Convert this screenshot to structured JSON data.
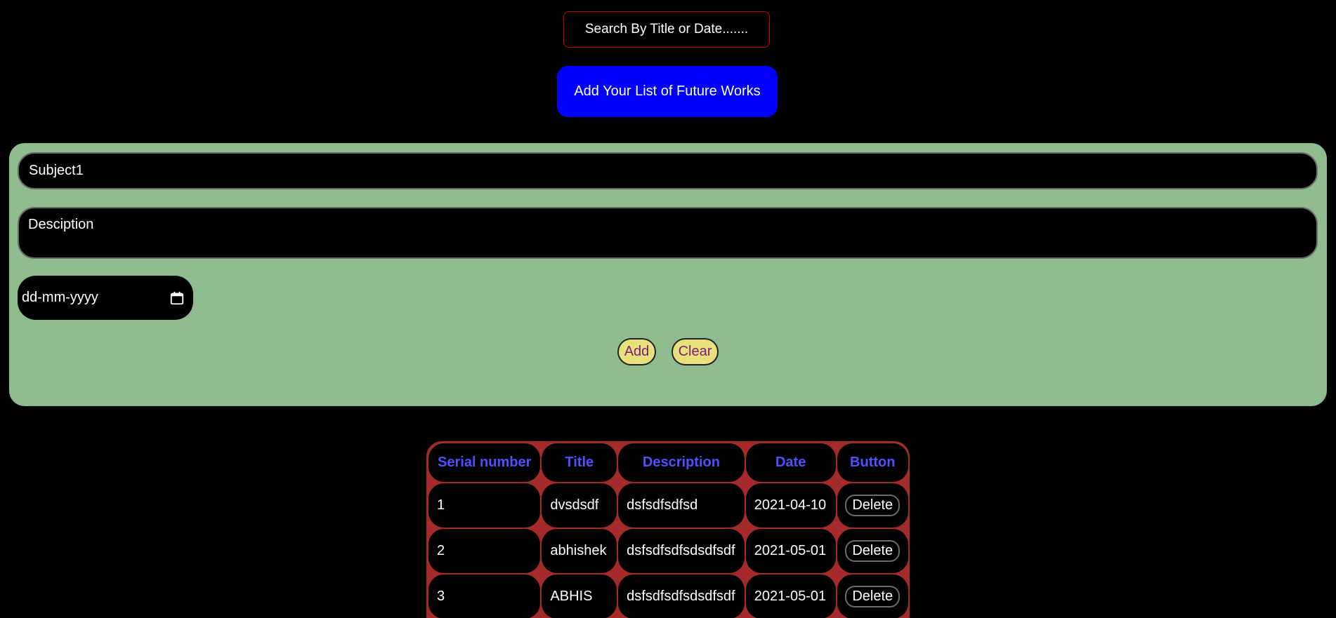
{
  "search": {
    "placeholder": "Search By Title or Date......."
  },
  "header": {
    "add_list_label": "Add Your List of Future Works"
  },
  "form": {
    "subject_value": "Subject1",
    "description_placeholder": "Desciption",
    "date_placeholder": "dd-mm-yyyy",
    "add_label": "Add",
    "clear_label": "Clear"
  },
  "table": {
    "headers": [
      "Serial number",
      "Title",
      "Description",
      "Date",
      "Button"
    ],
    "rows": [
      {
        "serial": "1",
        "title": "dvsdsdf",
        "description": "dsfsdfsdfsd",
        "date": "2021-04-10",
        "button": "Delete"
      },
      {
        "serial": "2",
        "title": "abhishek",
        "description": "dsfsdfsdfsdsdfsdf",
        "date": "2021-05-01",
        "button": "Delete"
      },
      {
        "serial": "3",
        "title": "ABHIS",
        "description": "dsfsdfsdfsdsdfsdf",
        "date": "2021-05-01",
        "button": "Delete"
      }
    ]
  },
  "colors": {
    "background": "#000000",
    "search_border": "#d00000",
    "heading_button": "#0000ff",
    "form_panel": "#8fbc8f",
    "action_button": "#e8e07a",
    "action_text": "#7a1f7a",
    "table_border": "#a52a2a",
    "table_header_text": "#5050ff"
  },
  "icons": {
    "date_picker": "calendar-icon"
  }
}
